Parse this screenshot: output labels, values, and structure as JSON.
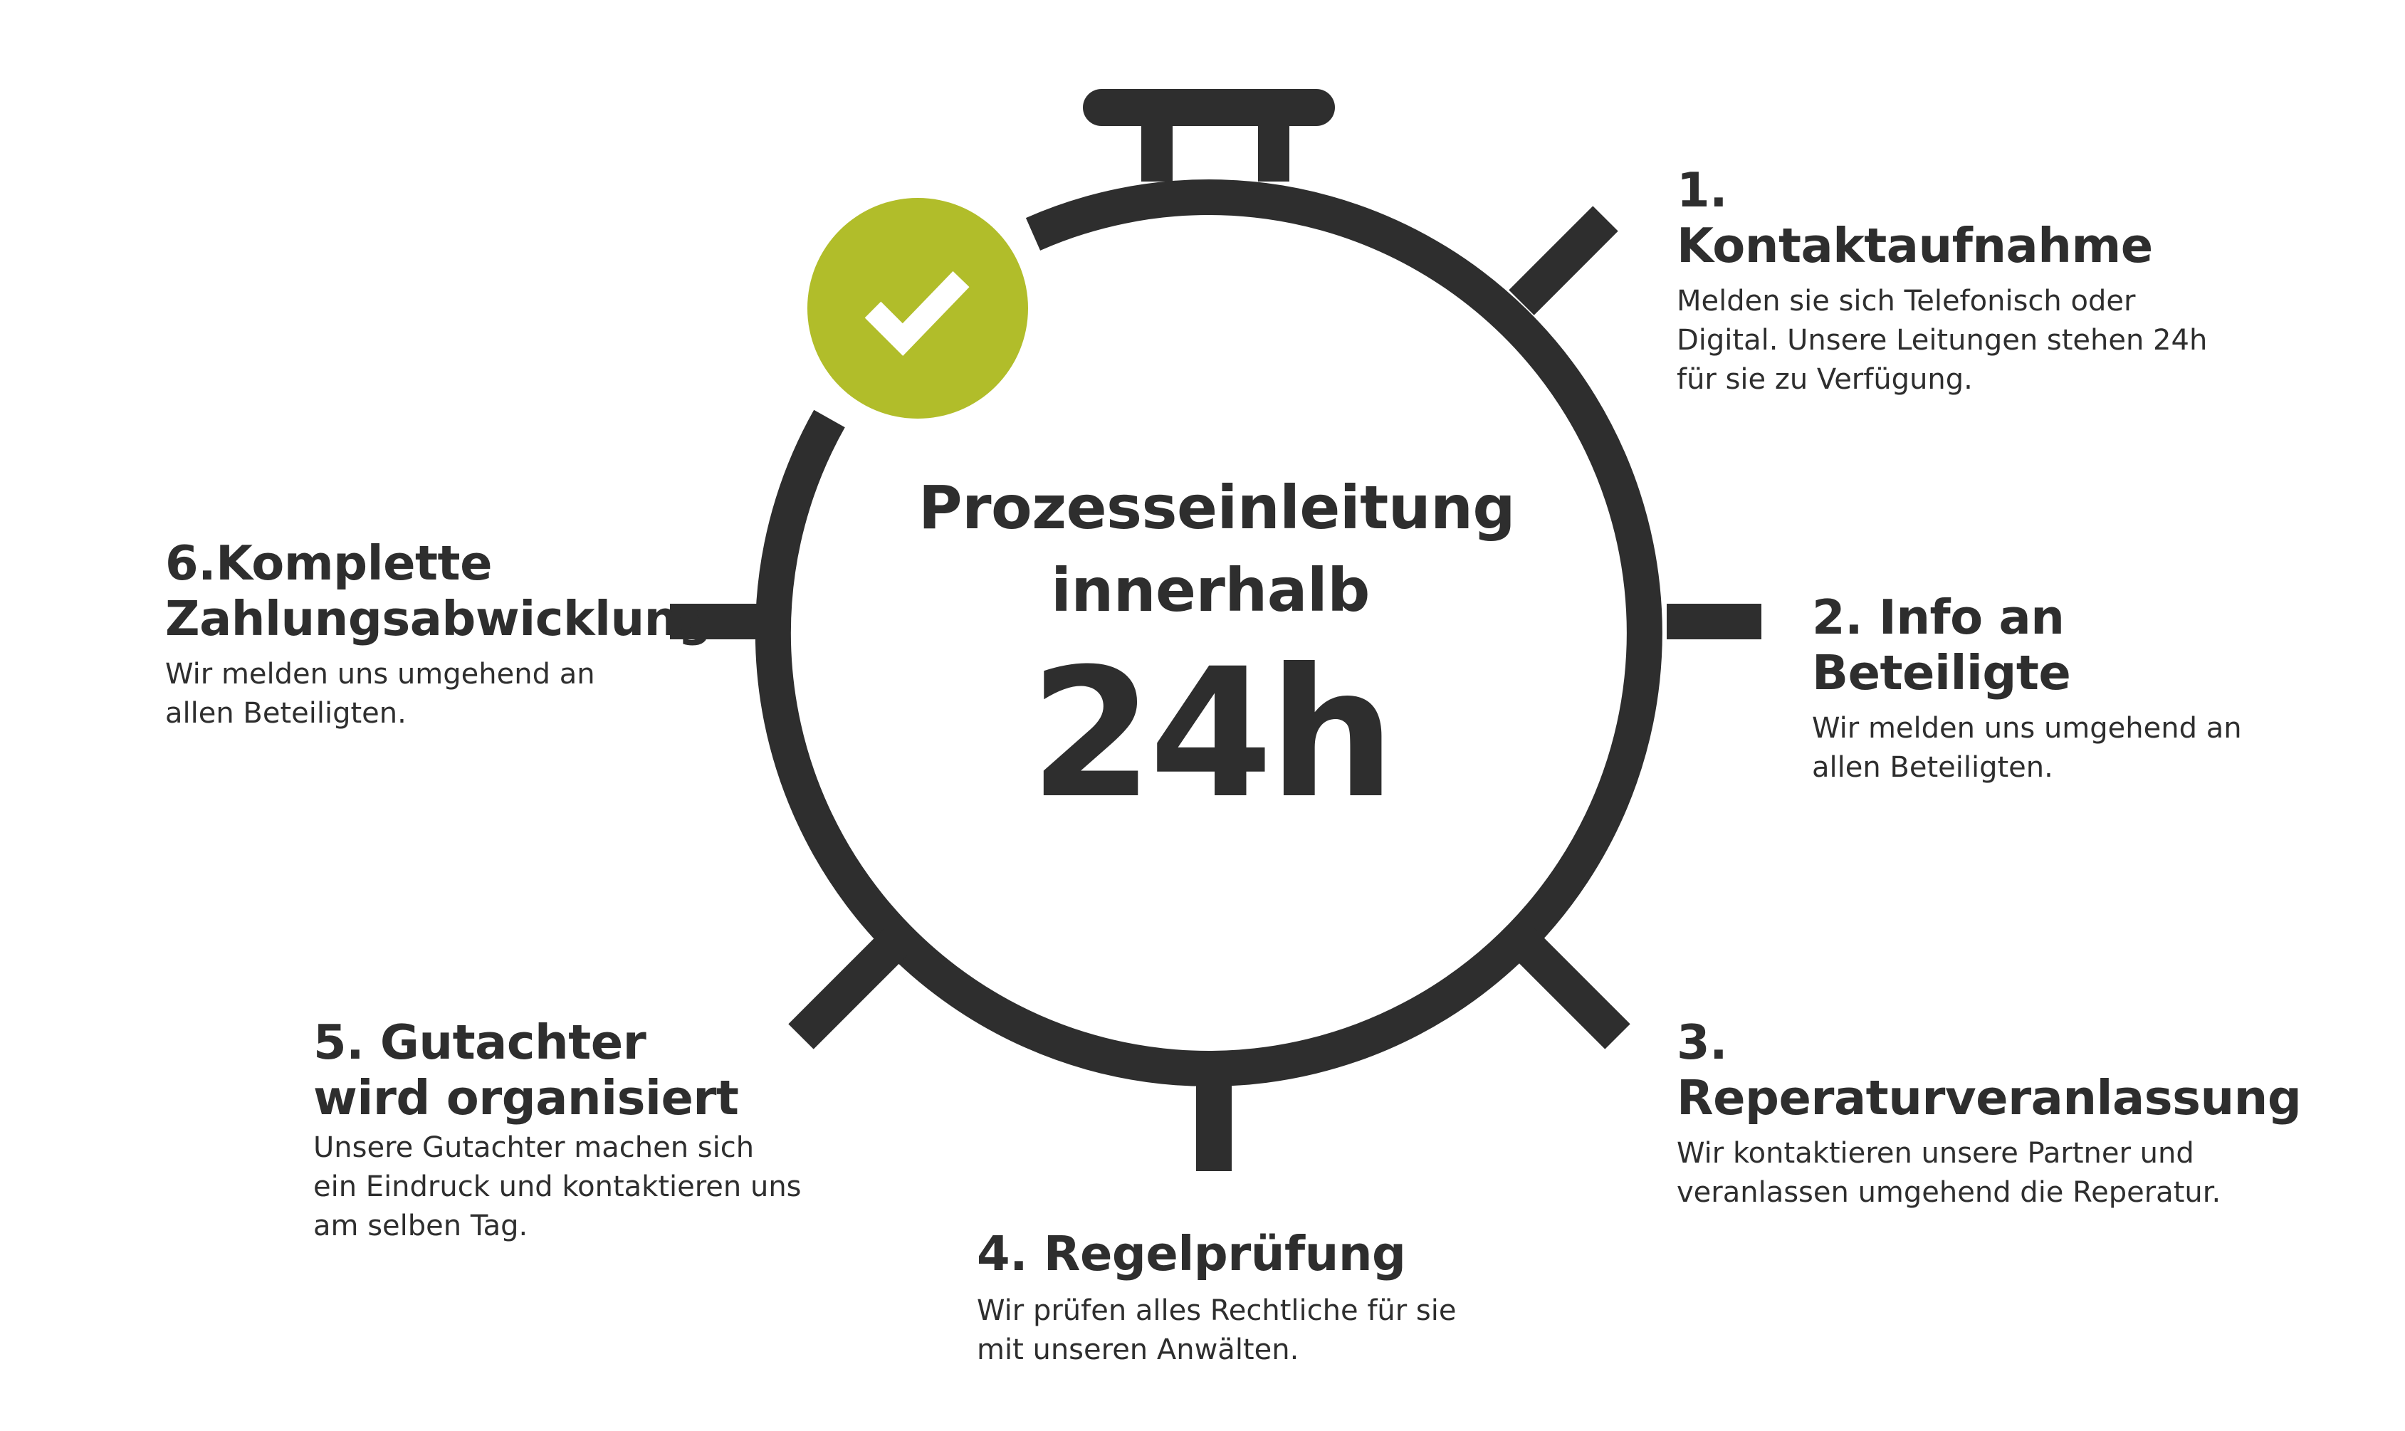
{
  "center": {
    "line1": "Prozesseinleitung",
    "line2": "innerhalb",
    "hours": "24h"
  },
  "steps": [
    {
      "title": "1. Kontaktaufnahme",
      "text": "Melden sie sich Telefonisch oder Digital. Unsere Leitungen stehen 24h für sie zu Verfügung."
    },
    {
      "title": "2. Info an Beteiligte",
      "text": "Wir melden uns umgehend an allen Beteiligten."
    },
    {
      "title": "3. Reperaturveranlassung",
      "text": "Wir kontaktieren unsere Partner und veranlassen umgehend die Reperatur."
    },
    {
      "title": "4. Regelprüfung",
      "text": "Wir prüfen alles Rechtliche für sie mit unseren Anwälten."
    },
    {
      "title": "5. Gutachter wird organisiert",
      "text": "Unsere Gutachter machen sich ein Eindruck und kontaktieren uns am selben Tag."
    },
    {
      "title": "6.Komplette Zahlungsabwicklung",
      "text": "Wir melden uns umgehend an allen Beteiligten."
    }
  ],
  "colors": {
    "stroke": "#2e2e2e",
    "accent": "#b1bd2a",
    "text": "#2e2e2e"
  },
  "icons": {
    "check": "checkmark-icon"
  }
}
